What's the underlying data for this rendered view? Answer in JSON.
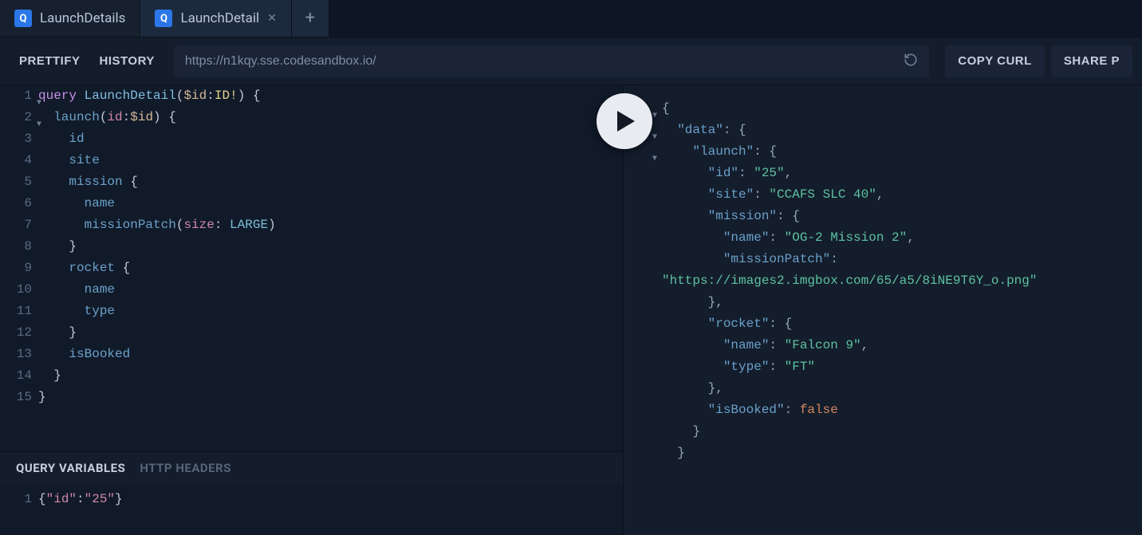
{
  "tabs": [
    {
      "label": "LaunchDetails",
      "active": false,
      "closeable": false
    },
    {
      "label": "LaunchDetail",
      "active": true,
      "closeable": true
    }
  ],
  "toolbar": {
    "prettify": "PRETTIFY",
    "history": "HISTORY",
    "copy_curl": "COPY CURL",
    "share": "SHARE P"
  },
  "endpoint": {
    "value": "https://n1kqy.sse.codesandbox.io/"
  },
  "editor": {
    "lines": [
      {
        "n": "1",
        "fold": true,
        "tokens": [
          [
            "k-q",
            "query"
          ],
          [
            "sp",
            " "
          ],
          [
            "k-name",
            "LaunchDetail"
          ],
          [
            "brace",
            "("
          ],
          [
            "k-var",
            "$id"
          ],
          [
            "brace",
            ":"
          ],
          [
            "k-type",
            "ID"
          ],
          [
            "k-bang",
            "!"
          ],
          [
            "brace",
            ") {"
          ]
        ]
      },
      {
        "n": "2",
        "fold": true,
        "indent": 1,
        "tokens": [
          [
            "k-field",
            "launch"
          ],
          [
            "brace",
            "("
          ],
          [
            "k-arg",
            "id"
          ],
          [
            "brace",
            ":"
          ],
          [
            "k-var",
            "$id"
          ],
          [
            "brace",
            ") {"
          ]
        ]
      },
      {
        "n": "3",
        "indent": 2,
        "tokens": [
          [
            "k-field",
            "id"
          ]
        ]
      },
      {
        "n": "4",
        "indent": 2,
        "tokens": [
          [
            "k-field",
            "site"
          ]
        ]
      },
      {
        "n": "5",
        "indent": 2,
        "tokens": [
          [
            "k-field",
            "mission"
          ],
          [
            "sp",
            " "
          ],
          [
            "brace",
            "{"
          ]
        ]
      },
      {
        "n": "6",
        "indent": 3,
        "tokens": [
          [
            "k-field",
            "name"
          ]
        ]
      },
      {
        "n": "7",
        "indent": 3,
        "tokens": [
          [
            "k-field",
            "missionPatch"
          ],
          [
            "brace",
            "("
          ],
          [
            "k-arg",
            "size"
          ],
          [
            "brace",
            ": "
          ],
          [
            "k-enum",
            "LARGE"
          ],
          [
            "brace",
            ")"
          ]
        ]
      },
      {
        "n": "8",
        "indent": 2,
        "tokens": [
          [
            "brace",
            "}"
          ]
        ]
      },
      {
        "n": "9",
        "indent": 2,
        "tokens": [
          [
            "k-field",
            "rocket"
          ],
          [
            "sp",
            " "
          ],
          [
            "brace",
            "{"
          ]
        ]
      },
      {
        "n": "10",
        "indent": 3,
        "tokens": [
          [
            "k-field",
            "name"
          ]
        ]
      },
      {
        "n": "11",
        "indent": 3,
        "tokens": [
          [
            "k-field",
            "type"
          ]
        ]
      },
      {
        "n": "12",
        "indent": 2,
        "tokens": [
          [
            "brace",
            "}"
          ]
        ]
      },
      {
        "n": "13",
        "indent": 2,
        "tokens": [
          [
            "k-field",
            "isBooked"
          ]
        ]
      },
      {
        "n": "14",
        "indent": 1,
        "tokens": [
          [
            "brace",
            "}"
          ]
        ]
      },
      {
        "n": "15",
        "indent": 0,
        "tokens": [
          [
            "brace",
            "}"
          ]
        ]
      }
    ]
  },
  "vars_panel": {
    "tabs": {
      "query_vars": "QUERY VARIABLES",
      "http_headers": "HTTP HEADERS"
    },
    "line_num": "1",
    "content_tokens": [
      [
        "j-brace",
        "{"
      ],
      [
        "j-key",
        "\"id\""
      ],
      [
        "j-brace",
        ":"
      ],
      [
        "j-str",
        "\"25\""
      ],
      [
        "j-brace",
        "}"
      ]
    ]
  },
  "result": {
    "lines": [
      {
        "fold": true,
        "indent": 0,
        "tokens": [
          [
            "rb",
            "{"
          ]
        ]
      },
      {
        "fold": true,
        "indent": 1,
        "tokens": [
          [
            "rk",
            "\"data\""
          ],
          [
            "rb",
            ": {"
          ]
        ]
      },
      {
        "fold": true,
        "indent": 2,
        "tokens": [
          [
            "rk",
            "\"launch\""
          ],
          [
            "rb",
            ": {"
          ]
        ]
      },
      {
        "indent": 3,
        "tokens": [
          [
            "rk",
            "\"id\""
          ],
          [
            "rb",
            ": "
          ],
          [
            "rs",
            "\"25\""
          ],
          [
            "rb",
            ","
          ]
        ]
      },
      {
        "indent": 3,
        "tokens": [
          [
            "rk",
            "\"site\""
          ],
          [
            "rb",
            ": "
          ],
          [
            "rs",
            "\"CCAFS SLC 40\""
          ],
          [
            "rb",
            ","
          ]
        ]
      },
      {
        "indent": 3,
        "tokens": [
          [
            "rk",
            "\"mission\""
          ],
          [
            "rb",
            ": {"
          ]
        ]
      },
      {
        "indent": 4,
        "tokens": [
          [
            "rk",
            "\"name\""
          ],
          [
            "rb",
            ": "
          ],
          [
            "rs",
            "\"OG-2 Mission 2\""
          ],
          [
            "rb",
            ","
          ]
        ]
      },
      {
        "indent": 4,
        "tokens": [
          [
            "rk",
            "\"missionPatch\""
          ],
          [
            "rb",
            ":"
          ]
        ]
      },
      {
        "indent": 0,
        "tokens": [
          [
            "rs",
            "\"https://images2.imgbox.com/65/a5/8iNE9T6Y_o.png\""
          ]
        ]
      },
      {
        "indent": 3,
        "tokens": [
          [
            "rb",
            "},"
          ]
        ]
      },
      {
        "indent": 3,
        "tokens": [
          [
            "rk",
            "\"rocket\""
          ],
          [
            "rb",
            ": {"
          ]
        ]
      },
      {
        "indent": 4,
        "tokens": [
          [
            "rk",
            "\"name\""
          ],
          [
            "rb",
            ": "
          ],
          [
            "rs",
            "\"Falcon 9\""
          ],
          [
            "rb",
            ","
          ]
        ]
      },
      {
        "indent": 4,
        "tokens": [
          [
            "rk",
            "\"type\""
          ],
          [
            "rb",
            ": "
          ],
          [
            "rs",
            "\"FT\""
          ]
        ]
      },
      {
        "indent": 3,
        "tokens": [
          [
            "rb",
            "},"
          ]
        ]
      },
      {
        "indent": 3,
        "tokens": [
          [
            "rk",
            "\"isBooked\""
          ],
          [
            "rb",
            ": "
          ],
          [
            "rn",
            "false"
          ]
        ]
      },
      {
        "indent": 2,
        "tokens": [
          [
            "rb",
            "}"
          ]
        ]
      },
      {
        "indent": 1,
        "tokens": [
          [
            "rb",
            "}"
          ]
        ]
      }
    ]
  }
}
